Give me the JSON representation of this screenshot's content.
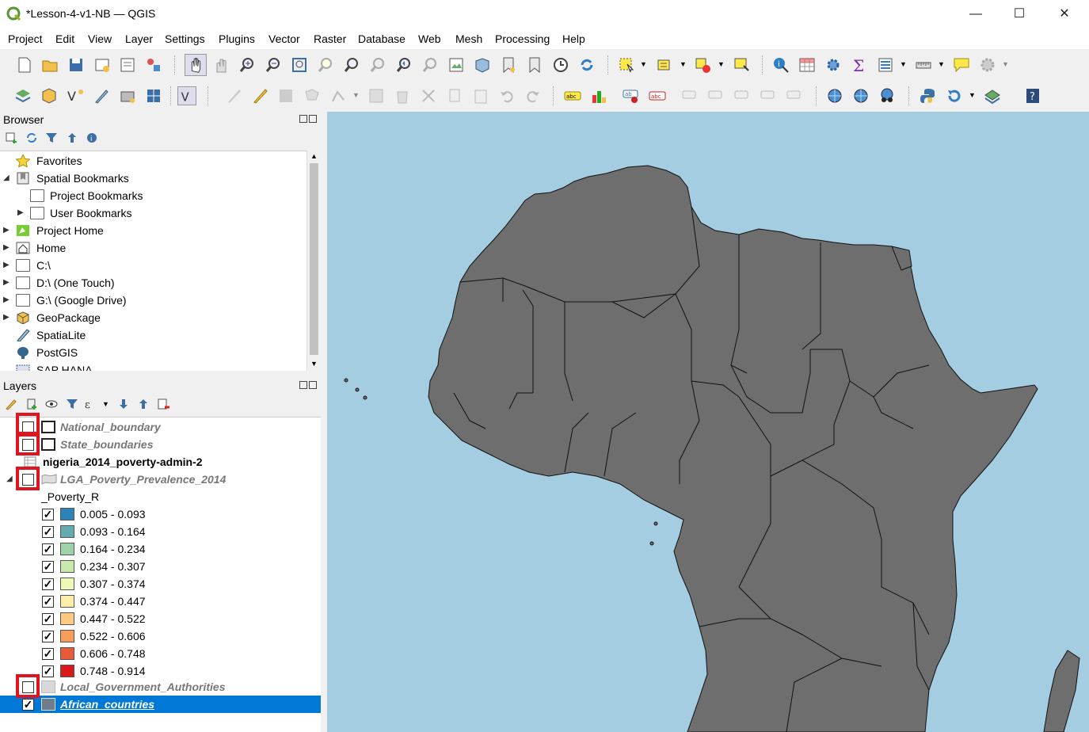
{
  "window": {
    "title": "*Lesson-4-v1-NB — QGIS",
    "minimize": "—",
    "maximize": "☐",
    "close": "✕"
  },
  "menu": [
    "Project",
    "Edit",
    "View",
    "Layer",
    "Settings",
    "Plugins",
    "Vector",
    "Raster",
    "Database",
    "Web",
    "Mesh",
    "Processing",
    "Help"
  ],
  "browser": {
    "title": "Browser",
    "items": [
      {
        "label": "Favorites",
        "icon": "star-icon"
      },
      {
        "label": "Spatial Bookmarks",
        "icon": "bookmarks-icon"
      },
      {
        "label": "Project Bookmarks",
        "icon": "folder-icon"
      },
      {
        "label": "User Bookmarks",
        "icon": "folder-icon"
      },
      {
        "label": "Project Home",
        "icon": "project-home-icon"
      },
      {
        "label": "Home",
        "icon": "home-icon"
      },
      {
        "label": "C:\\",
        "icon": "folder-icon"
      },
      {
        "label": "D:\\ (One Touch)",
        "icon": "folder-icon"
      },
      {
        "label": "G:\\ (Google Drive)",
        "icon": "folder-icon"
      },
      {
        "label": "GeoPackage",
        "icon": "geopackage-icon"
      },
      {
        "label": "SpatiaLite",
        "icon": "spatialite-icon"
      },
      {
        "label": "PostGIS",
        "icon": "postgis-icon"
      },
      {
        "label": "SAP HANA",
        "icon": "saphana-icon"
      }
    ]
  },
  "layers": {
    "title": "Layers",
    "items": [
      {
        "label": "National_boundary",
        "checked": false,
        "style": "italic"
      },
      {
        "label": "State_boundaries",
        "checked": false,
        "style": "italic"
      },
      {
        "label": "nigeria_2014_poverty-admin-2",
        "style": "bold"
      },
      {
        "label": "LGA_Poverty_Prevalence_2014",
        "checked": false,
        "style": "italic"
      },
      {
        "label": "_Poverty_R"
      },
      {
        "label": "Local_Government_Authorities",
        "checked": false,
        "style": "italic"
      },
      {
        "label": "African_countries",
        "checked": true,
        "style": "selected"
      }
    ],
    "classes": [
      {
        "label": "0.005 - 0.093",
        "color": "#2b83ba"
      },
      {
        "label": "0.093 - 0.164",
        "color": "#64abb0"
      },
      {
        "label": "0.164 - 0.234",
        "color": "#9dd3a7"
      },
      {
        "label": "0.234 - 0.307",
        "color": "#c7e9ad"
      },
      {
        "label": "0.307 - 0.374",
        "color": "#edf8b9"
      },
      {
        "label": "0.374 - 0.447",
        "color": "#ffedaa"
      },
      {
        "label": "0.447 - 0.522",
        "color": "#fec980"
      },
      {
        "label": "0.522 - 0.606",
        "color": "#f99e59"
      },
      {
        "label": "0.606 - 0.748",
        "color": "#e85b3a"
      },
      {
        "label": "0.748 - 0.914",
        "color": "#d7191c"
      }
    ]
  },
  "colors": {
    "map_water": "#a5cde1",
    "map_land": "#6e6e6e",
    "selection": "#0078d7",
    "highlight_box": "#e0141e"
  }
}
